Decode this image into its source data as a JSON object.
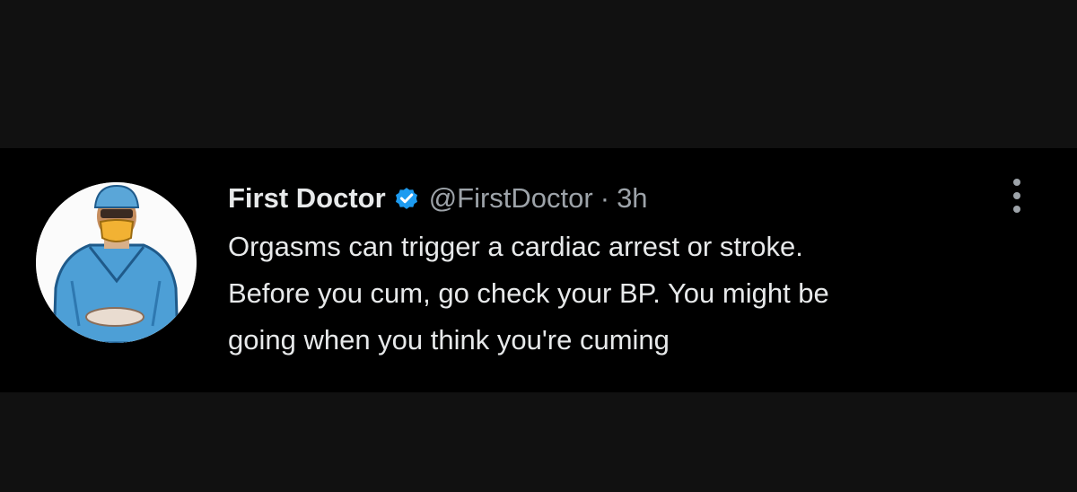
{
  "tweet": {
    "author": {
      "display_name": "First Doctor",
      "handle": "@FirstDoctor",
      "verified": true,
      "avatar_icon": "doctor-in-scrubs-avatar"
    },
    "separator": "·",
    "time_ago": "3h",
    "text": "Orgasms can trigger a cardiac arrest or stroke.\nBefore you cum, go check your BP. You might be\ngoing when you think you're cuming",
    "more_icon": "more-vertical-icon"
  },
  "colors": {
    "background": "#000000",
    "frame": "#111111",
    "primary_text": "#e7e9ea",
    "secondary_text": "#9da3a9",
    "verified_badge": "#1d9bf0"
  }
}
